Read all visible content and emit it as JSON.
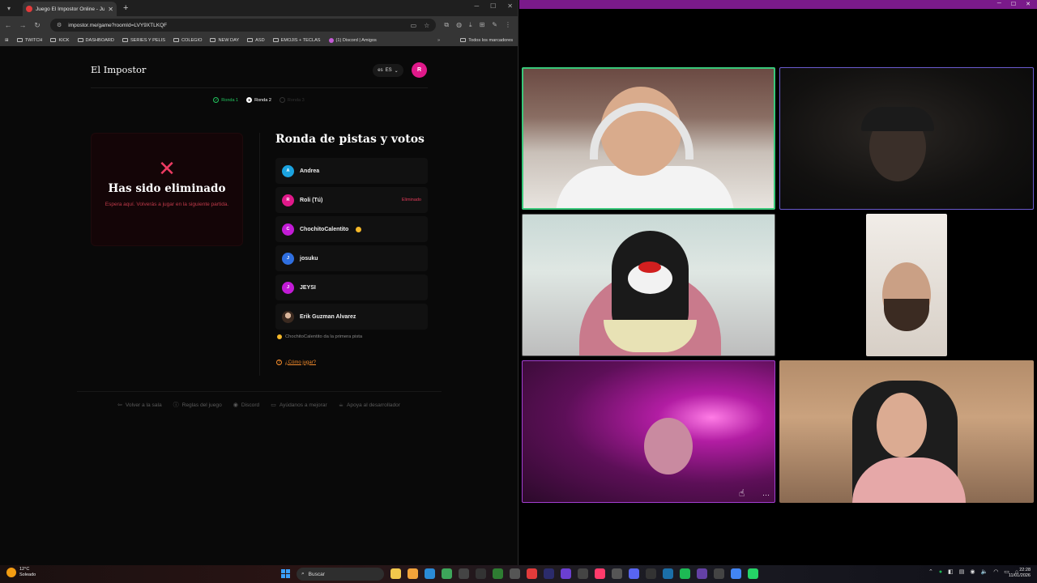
{
  "browser": {
    "tab_title": "Juego El Impostor Online - Jug",
    "url": "impostor.me/game?roomId=LVY9XTLKQF",
    "bookmarks": [
      "TWITCH",
      "KICK",
      "DASHBOARD",
      "SERIES Y PELIS",
      "COLEGIO",
      "NEW DAY",
      "ASD",
      "EMOJIS + TECLAS",
      "(1) Discord | Amigos"
    ],
    "all_bookmarks": "Todos los marcadores"
  },
  "game": {
    "brand": "El Impostor",
    "language": "ES",
    "user_initial": "R",
    "rounds": [
      {
        "label": "Ronda 1",
        "state": "done"
      },
      {
        "label": "Ronda 2",
        "state": "current"
      },
      {
        "label": "Ronda 3",
        "state": "pending"
      }
    ],
    "eliminated": {
      "title": "Has sido eliminado",
      "subtitle": "Espera aquí. Volverás a jugar en la siguiente partida."
    },
    "panel_title": "Ronda de pistas y votos",
    "players": [
      {
        "initial": "A",
        "name": "Andrea",
        "color": "#1ba3e0",
        "badge": ""
      },
      {
        "initial": "R",
        "name": "Roli (Tú)",
        "color": "#e0198a",
        "badge": "Eliminado"
      },
      {
        "initial": "C",
        "name": "ChochitoCalentito",
        "color": "#c21bd6",
        "badge": ""
      },
      {
        "initial": "J",
        "name": "josuku",
        "color": "#2f6fe0",
        "badge": ""
      },
      {
        "initial": "J",
        "name": "JEYSI",
        "color": "#c21bd6",
        "badge": ""
      },
      {
        "initial": "",
        "name": "Erik Guzman Alvarez",
        "color": "#6b4b3b",
        "badge": ""
      }
    ],
    "first_clue": "ChochitoCalentito da la primera pista",
    "how_to_play": "¿Cómo jugar?",
    "footer": [
      "Volver a la sala",
      "Reglas del juego",
      "Discord",
      "Ayúdanos a mejorar",
      "Apoya al desarrollador"
    ]
  },
  "taskbar": {
    "temperature": "12°C",
    "weather": "Soleado",
    "search_placeholder": "Buscar",
    "time": "22:28",
    "date": "11/01/2026"
  },
  "colors": {
    "accent": "#e0198a",
    "eliminated_red": "#ec3b62",
    "round_done": "#22c55e",
    "how_to_play": "#f28b2c"
  }
}
